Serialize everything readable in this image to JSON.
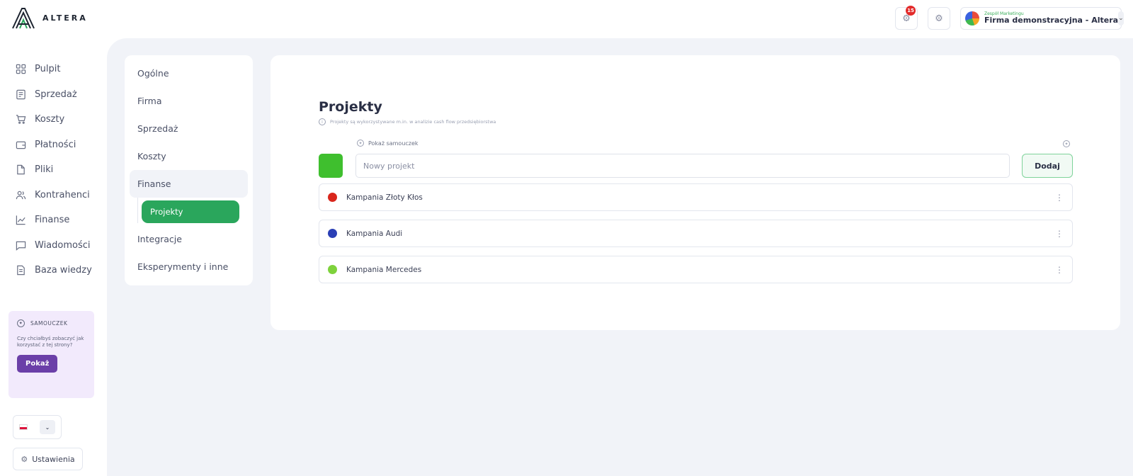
{
  "brand": {
    "name": "ALTERA"
  },
  "header": {
    "notifications_count": "15",
    "company_team": "Zespół Marketingu",
    "company_name": "Firma demonstracyjna - Altera"
  },
  "sidebar": {
    "items": [
      {
        "label": "Pulpit",
        "icon": "grid-icon"
      },
      {
        "label": "Sprzedaż",
        "icon": "invoice-icon"
      },
      {
        "label": "Koszty",
        "icon": "cart-icon"
      },
      {
        "label": "Płatności",
        "icon": "wallet-icon"
      },
      {
        "label": "Pliki",
        "icon": "file-icon"
      },
      {
        "label": "Kontrahenci",
        "icon": "people-icon"
      },
      {
        "label": "Finanse",
        "icon": "chart-icon"
      },
      {
        "label": "Wiadomości",
        "icon": "message-icon"
      },
      {
        "label": "Baza wiedzy",
        "icon": "book-icon"
      }
    ],
    "tutorial": {
      "title": "SAMOUCZEK",
      "text": "Czy chciałbyś zobaczyć jak korzystać z tej strony?",
      "button": "Pokaż"
    },
    "settings_label": "Ustawienia"
  },
  "settings_nav": {
    "items": [
      "Ogólne",
      "Firma",
      "Sprzedaż",
      "Koszty",
      "Finanse"
    ],
    "active_child": "Projekty",
    "items_after": [
      "Integracje",
      "Eksperymenty i inne"
    ]
  },
  "panel": {
    "title": "Projekty",
    "description": "Projekty są wykorzystywane m.in. w analizie cash flow przedsiębiorstwa",
    "show_tutorial": "Pokaż samouczek",
    "new_project_placeholder": "Nowy projekt",
    "new_project_color": "#3fbf2e",
    "add_button": "Dodaj",
    "projects": [
      {
        "name": "Kampania Złoty Kłos",
        "color": "#d9261c"
      },
      {
        "name": "Kampania Audi",
        "color": "#2a3fb5"
      },
      {
        "name": "Kampania Mercedes",
        "color": "#7ed23c"
      }
    ]
  }
}
